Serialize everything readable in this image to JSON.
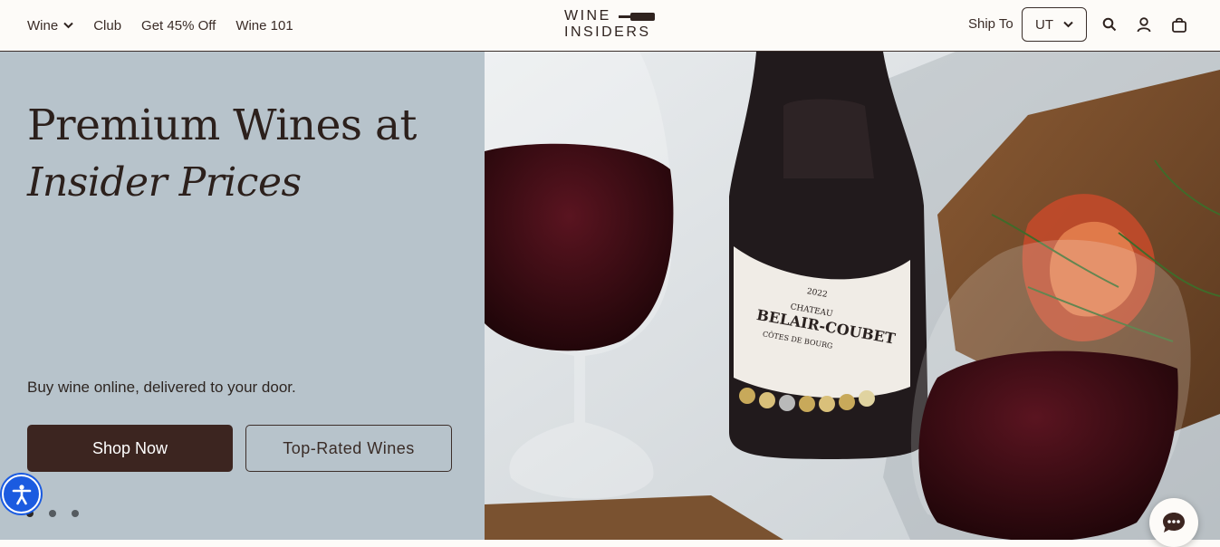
{
  "header": {
    "nav": [
      {
        "label": "Wine"
      },
      {
        "label": "Club"
      },
      {
        "label": "Get 45% Off"
      },
      {
        "label": "Wine 101"
      }
    ],
    "logo_line1": "WINE",
    "logo_line2": "INSIDERS",
    "ship_to_label": "Ship To",
    "ship_to_value": "UT"
  },
  "hero": {
    "headline_line1": "Premium Wines at",
    "headline_line2": "Insider Prices",
    "subtext": "Buy wine online, delivered to your door.",
    "primary_button": "Shop Now",
    "secondary_button": "Top-Rated Wines",
    "slide_count": 3,
    "active_slide": 1,
    "image_label_line1": "CHATEAU",
    "image_label_line2": "BELAIR-COUBET",
    "image_label_year": "2022",
    "image_label_region": "CÔTES DE BOURG"
  },
  "colors": {
    "accent": "#3c2520",
    "hero_panel": "#b7c3cb",
    "accessibility": "#1b5be0"
  },
  "icons": [
    "chevron-down-icon",
    "wine-bottle-icon",
    "search-icon",
    "user-icon",
    "shopping-bag-icon",
    "accessibility-icon",
    "chat-icon"
  ]
}
